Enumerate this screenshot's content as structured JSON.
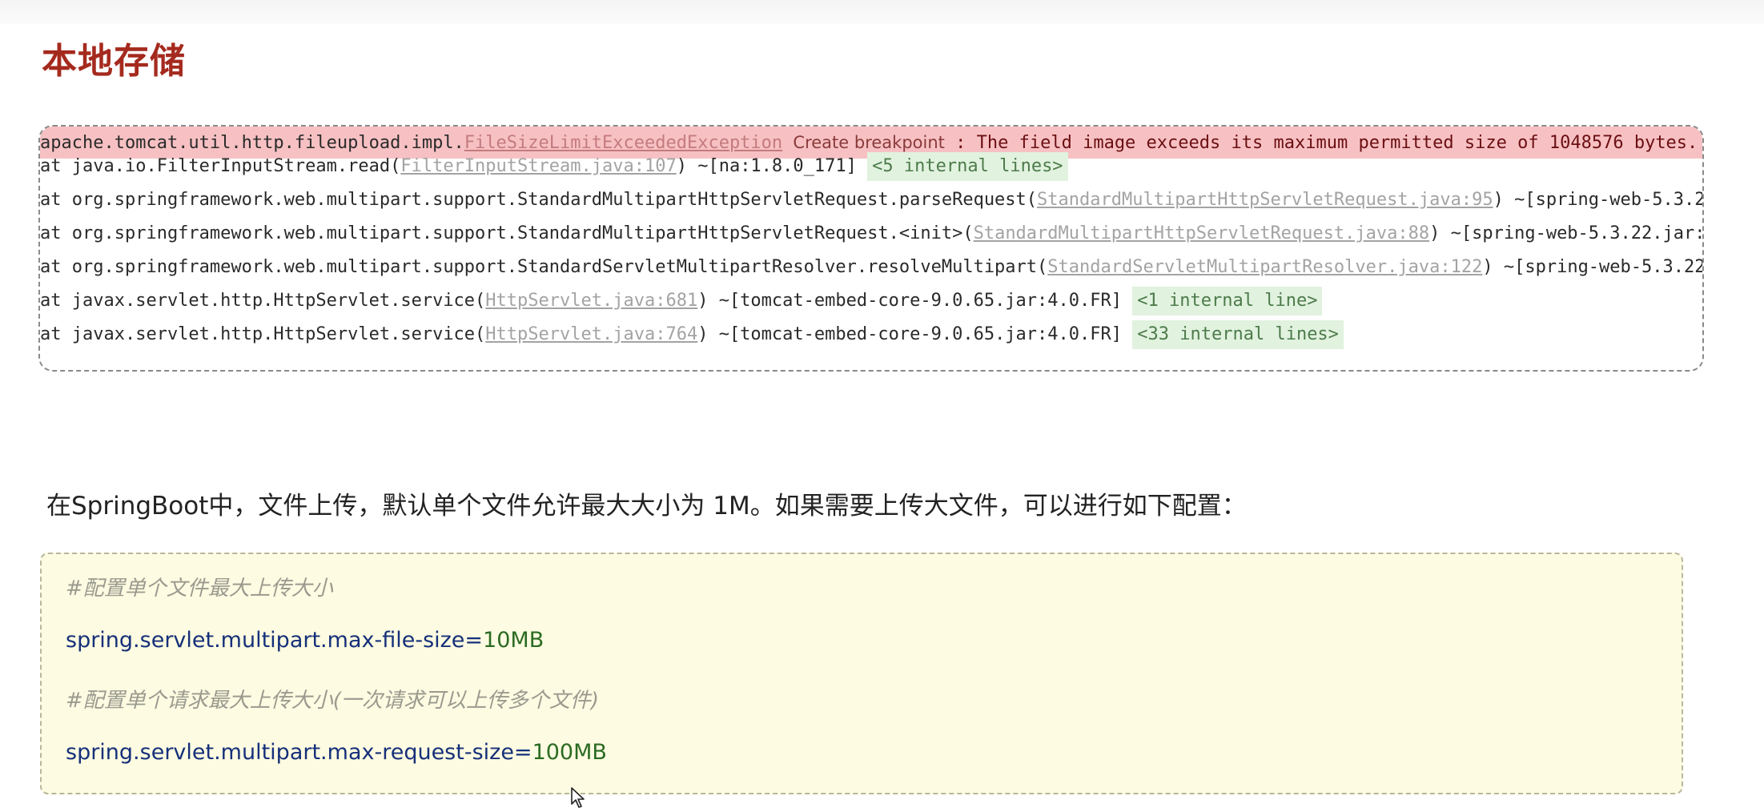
{
  "page": {
    "title": "本地存储"
  },
  "stacktrace": {
    "lines": [
      {
        "prefix": "apache.tomcat.util.http.fileupload.impl.",
        "link": "FileSizeLimitExceededException",
        "breakpoint": "Create breakpoint",
        "message": " : The field image exceeds its maximum permitted size of 1048576 bytes.",
        "tail": "<"
      },
      {
        "prefix": "at java.io.FilterInputStream.read(",
        "link": "FilterInputStream.java:107",
        "suffix": ") ~[na:1.8.0_171] ",
        "internal": "<5 internal lines>"
      },
      {
        "prefix": "at org.springframework.web.multipart.support.StandardMultipartHttpServletRequest.parseRequest(",
        "link": "StandardMultipartHttpServletRequest.java:95",
        "suffix": ") ~[spring-web-5.3.2"
      },
      {
        "prefix": "at org.springframework.web.multipart.support.StandardMultipartHttpServletRequest.<init>(",
        "link": "StandardMultipartHttpServletRequest.java:88",
        "suffix": ") ~[spring-web-5.3.22.jar:"
      },
      {
        "prefix": "at org.springframework.web.multipart.support.StandardServletMultipartResolver.resolveMultipart(",
        "link": "StandardServletMultipartResolver.java:122",
        "suffix": ") ~[spring-web-5.3.22"
      },
      {
        "prefix": "at javax.servlet.http.HttpServlet.service(",
        "link": "HttpServlet.java:681",
        "suffix": ") ~[tomcat-embed-core-9.0.65.jar:4.0.FR] ",
        "internal": "<1 internal line>"
      },
      {
        "prefix": "at javax.servlet.http.HttpServlet.service(",
        "link": "HttpServlet.java:764",
        "suffix": ") ~[tomcat-embed-core-9.0.65.jar:4.0.FR] ",
        "internal": "<33 internal lines>"
      }
    ]
  },
  "description": "在SpringBoot中，文件上传，默认单个文件允许最大大小为 1M。如果需要上传大文件，可以进行如下配置：",
  "config": {
    "comment1": "#配置单个文件最大上传大小",
    "line1_key": "spring.servlet.multipart.max-file-size=",
    "line1_value": "10MB",
    "comment2": "#配置单个请求最大上传大小(一次请求可以上传多个文件)",
    "line2_key": "spring.servlet.multipart.max-request-size=",
    "line2_value": "100MB"
  },
  "icons": {
    "cursor": "mouse-pointer-icon"
  }
}
